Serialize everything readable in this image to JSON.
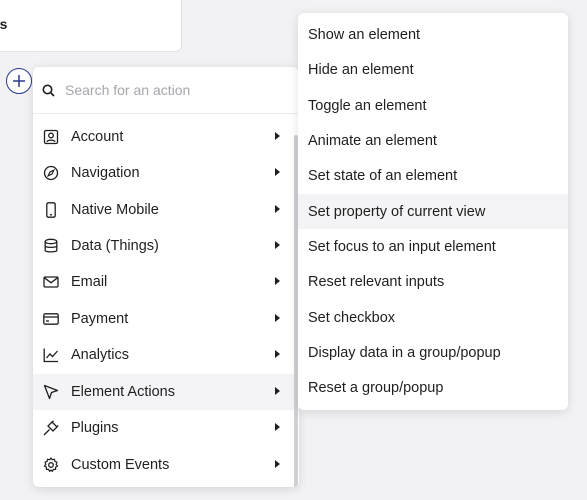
{
  "top_card": {
    "text": "ts"
  },
  "add_button": {
    "label": "+"
  },
  "search": {
    "placeholder": "Search for an action",
    "value": ""
  },
  "menu": {
    "items": [
      {
        "label": "Account",
        "icon": "account-icon"
      },
      {
        "label": "Navigation",
        "icon": "compass-icon"
      },
      {
        "label": "Native Mobile",
        "icon": "mobile-icon"
      },
      {
        "label": "Data (Things)",
        "icon": "database-icon"
      },
      {
        "label": "Email",
        "icon": "email-icon"
      },
      {
        "label": "Payment",
        "icon": "credit-card-icon"
      },
      {
        "label": "Analytics",
        "icon": "chart-line-icon"
      },
      {
        "label": "Element Actions",
        "icon": "cursor-icon",
        "active": true
      },
      {
        "label": "Plugins",
        "icon": "plug-icon"
      },
      {
        "label": "Custom Events",
        "icon": "gear-icon"
      }
    ]
  },
  "submenu": {
    "items": [
      {
        "label": "Show an element"
      },
      {
        "label": "Hide an element"
      },
      {
        "label": "Toggle an element"
      },
      {
        "label": "Animate an element"
      },
      {
        "label": "Set state of an element"
      },
      {
        "label": "Set property of current view",
        "hover": true
      },
      {
        "label": "Set focus to an input element"
      },
      {
        "label": "Reset relevant inputs"
      },
      {
        "label": "Set checkbox"
      },
      {
        "label": "Display data in a group/popup"
      },
      {
        "label": "Reset a group/popup"
      }
    ]
  },
  "colors": {
    "background": "#f2f2f4",
    "accent": "#2b3a8c",
    "hover": "#f4f4f6",
    "text": "#1f1f1f"
  }
}
